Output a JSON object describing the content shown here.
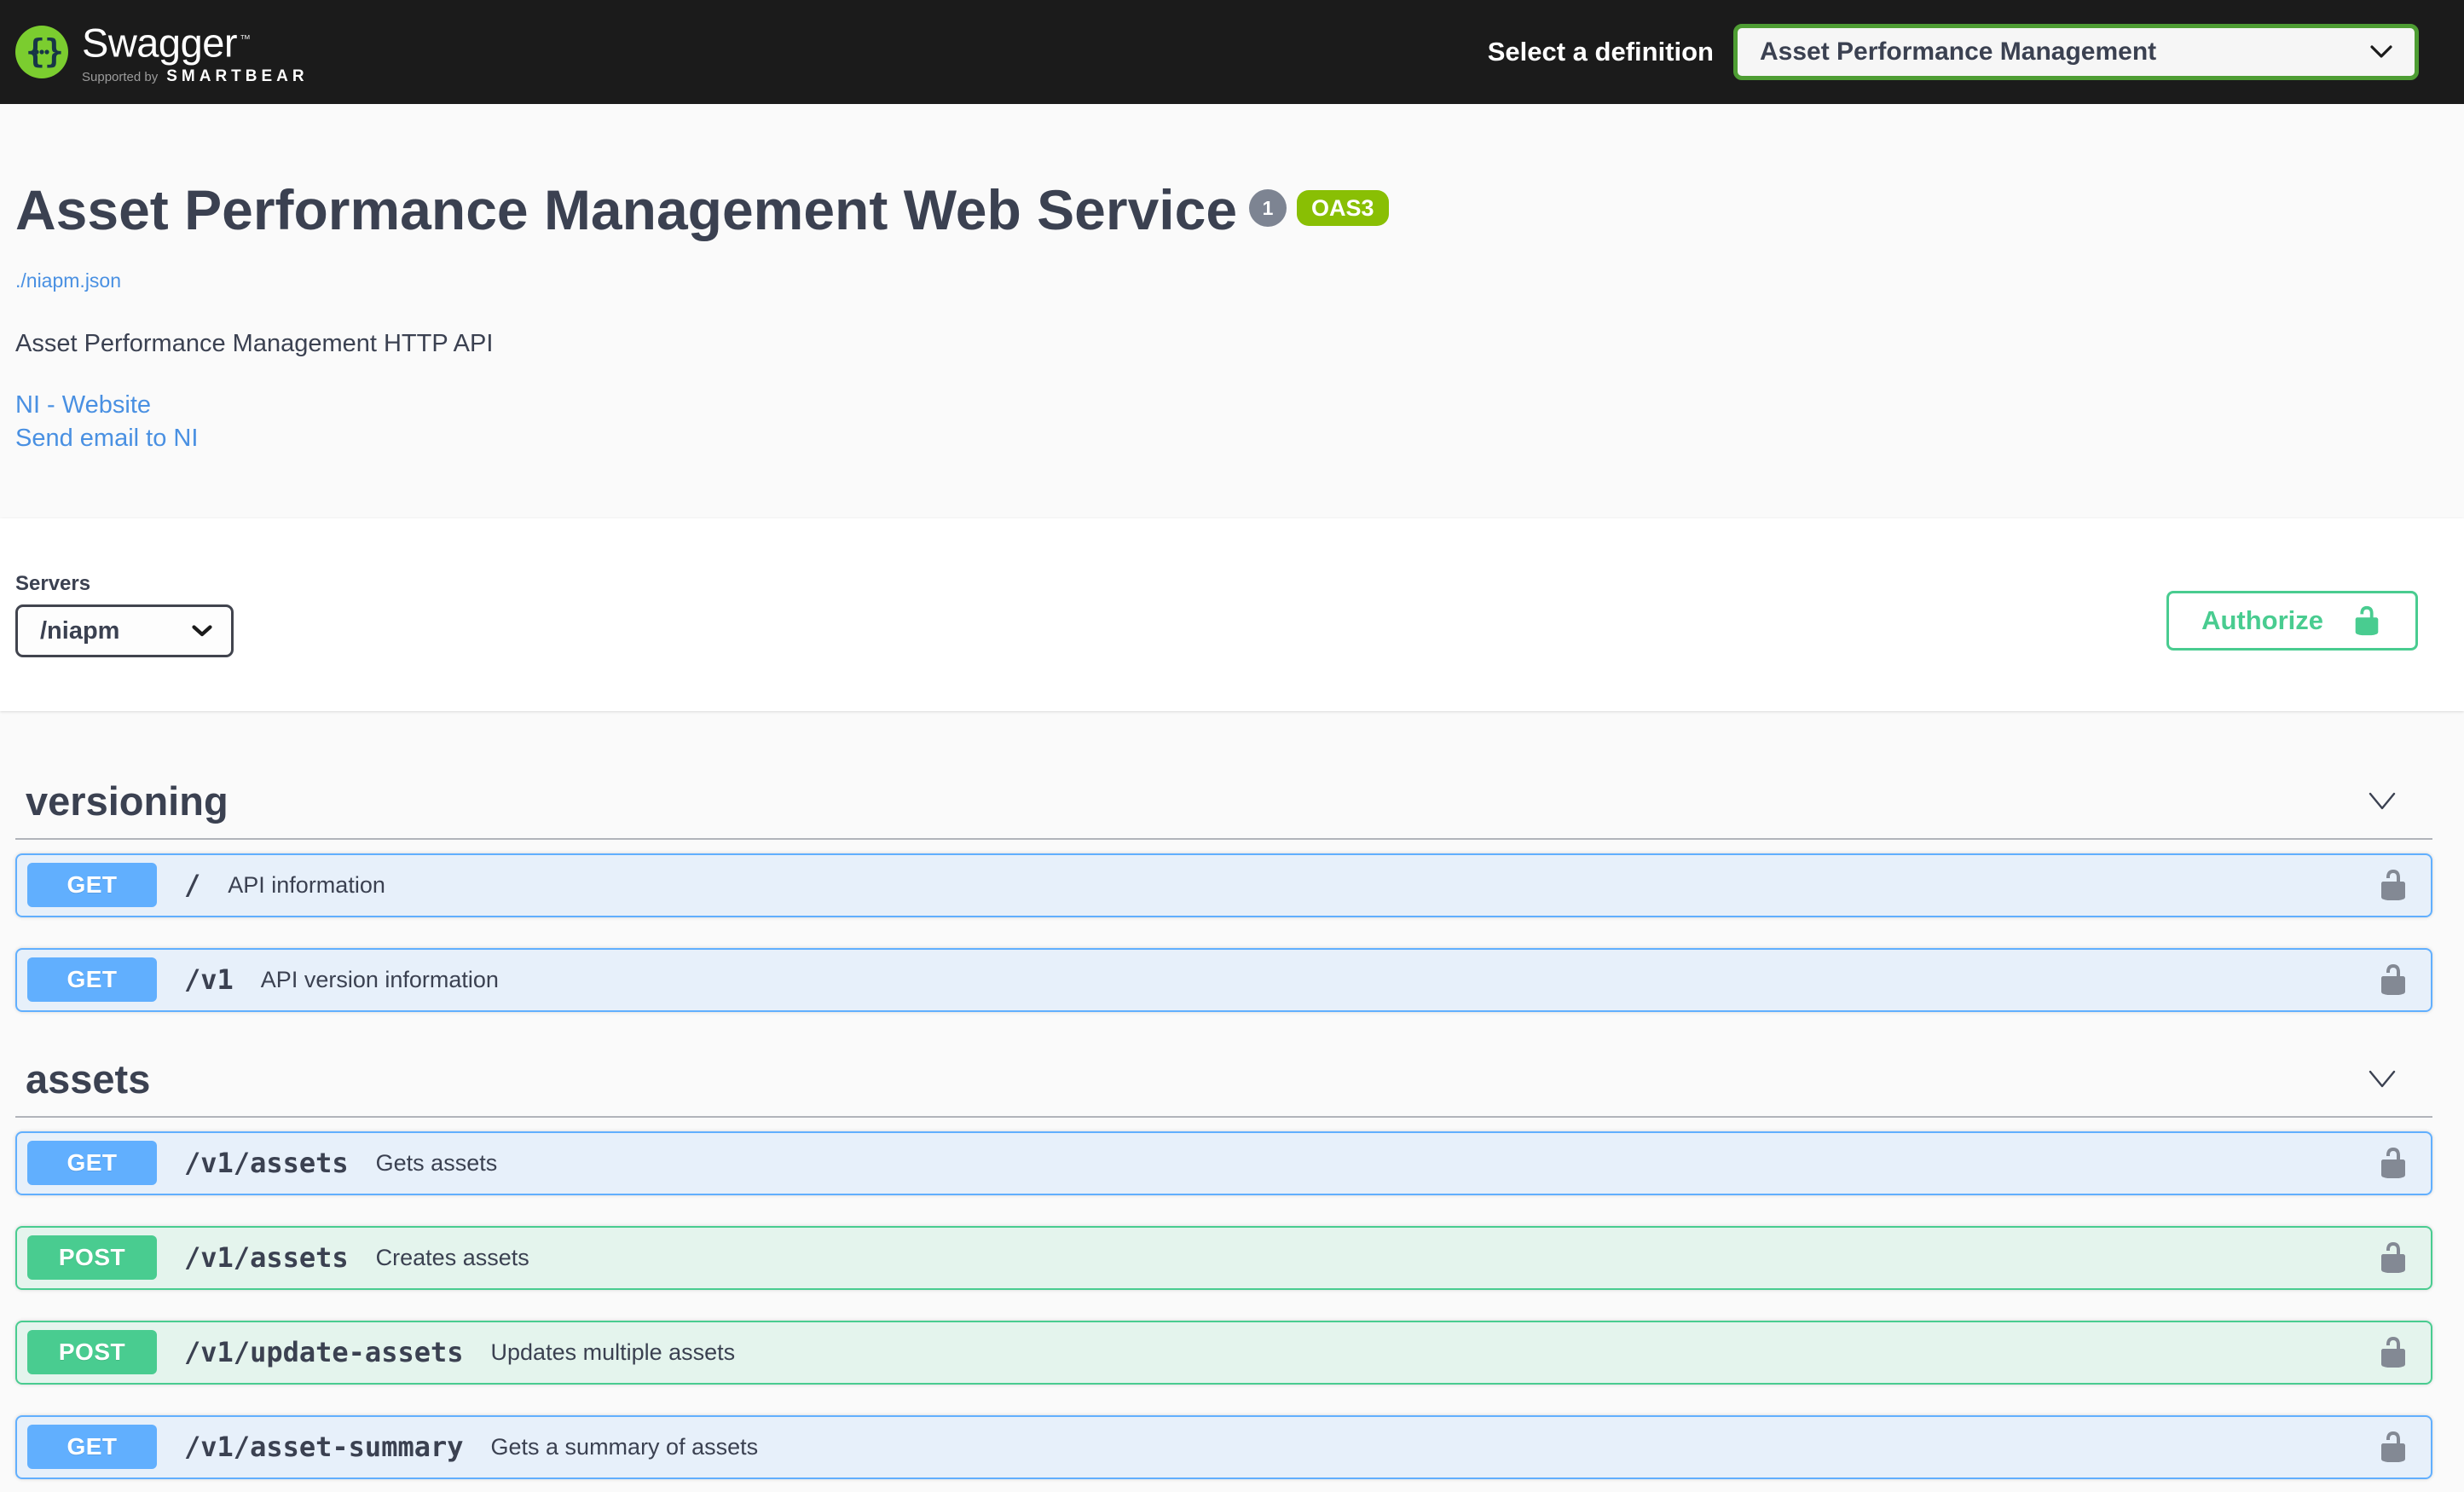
{
  "topbar": {
    "brand": "Swagger",
    "trademark": "™",
    "supported_by": "Supported by",
    "supported_brand": "SMARTBEAR",
    "definition_label": "Select a definition",
    "definition_value": "Asset Performance Management"
  },
  "info": {
    "title": "Asset Performance Management Web Service",
    "version_badge": "1",
    "oas_badge": "OAS3",
    "spec_link": "./niapm.json",
    "description": "Asset Performance Management HTTP API",
    "website_link": "NI - Website",
    "email_link": "Send email to NI"
  },
  "servers": {
    "label": "Servers",
    "selected": "/niapm"
  },
  "auth": {
    "authorize_label": "Authorize"
  },
  "sections": [
    {
      "title": "versioning",
      "operations": [
        {
          "method": "GET",
          "path": "/",
          "summary": "API information"
        },
        {
          "method": "GET",
          "path": "/v1",
          "summary": "API version information"
        }
      ]
    },
    {
      "title": "assets",
      "operations": [
        {
          "method": "GET",
          "path": "/v1/assets",
          "summary": "Gets assets"
        },
        {
          "method": "POST",
          "path": "/v1/assets",
          "summary": "Creates assets"
        },
        {
          "method": "POST",
          "path": "/v1/update-assets",
          "summary": "Updates multiple assets"
        },
        {
          "method": "GET",
          "path": "/v1/asset-summary",
          "summary": "Gets a summary of assets"
        }
      ]
    }
  ],
  "colors": {
    "topbar_bg": "#1b1b1b",
    "get": "#61affe",
    "post": "#49cc90",
    "link": "#4990e2",
    "auth_green": "#49cc90",
    "oas3_badge": "#89bf04",
    "version_badge": "#7d8492",
    "select_border": "#4e9d33",
    "logo_green": "#7bcd2f"
  }
}
